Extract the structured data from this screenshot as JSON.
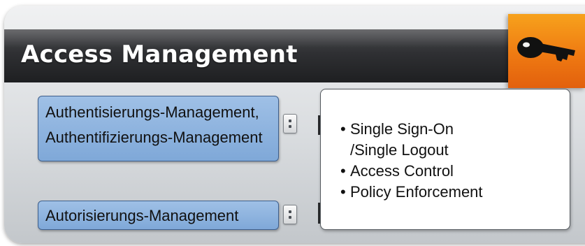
{
  "header": {
    "title": "Access Management",
    "icon": "key-icon",
    "badge_color": "#ef7a12"
  },
  "left": {
    "authentication": {
      "line1": "Authentisierungs-Management,",
      "line2": "Authentifizierungs-Management"
    },
    "authorization": {
      "label": "Autorisierungs-Management"
    },
    "box_color": "#8fb4df"
  },
  "detail": {
    "items": [
      {
        "bullet": "•",
        "line1": "Single Sign-On",
        "line2": "/Single Logout"
      },
      {
        "bullet": "•",
        "line1": "Access Control"
      },
      {
        "bullet": "•",
        "line1": "Policy Enforcement"
      }
    ]
  }
}
